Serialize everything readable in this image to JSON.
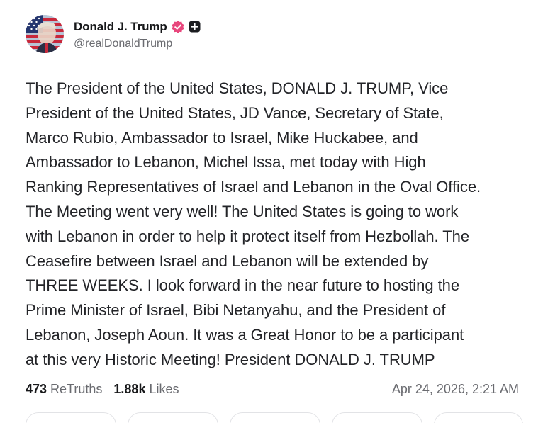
{
  "author": {
    "display_name": "Donald J. Trump",
    "handle": "@realDonaldTrump",
    "avatar_icon": "american-flag-portrait-icon",
    "verified_icon": "verified-badge-icon",
    "verified_color": "#e8467c",
    "plus_icon": "plus-square-icon"
  },
  "post": {
    "lines": [
      "The President of the United States, DONALD J. TRUMP, Vice",
      "President of the United States, JD Vance, Secretary of State,",
      "Marco Rubio, Ambassador to Israel, Mike Huckabee, and",
      "Ambassador to Lebanon, Michel Issa, met today with High",
      "Ranking Representatives of Israel and Lebanon in the Oval Office.",
      "The Meeting went very well! The United States is going to work",
      "with Lebanon in order to help it protect itself from Hezbollah. The",
      "Ceasefire between Israel and Lebanon will be extended by",
      "THREE WEEKS. I look forward in the near future to hosting the",
      "Prime Minister of Israel, Bibi Netanyahu, and the President of",
      "Lebanon, Joseph Aoun. It was a Great Honor to be a participant",
      "at this very Historic Meeting! President DONALD J. TRUMP"
    ]
  },
  "stats": {
    "retruths_count": "473",
    "retruths_label": "ReTruths",
    "likes_count": "1.88k",
    "likes_label": "Likes"
  },
  "timestamp": "Apr 24, 2026, 2:21 AM"
}
